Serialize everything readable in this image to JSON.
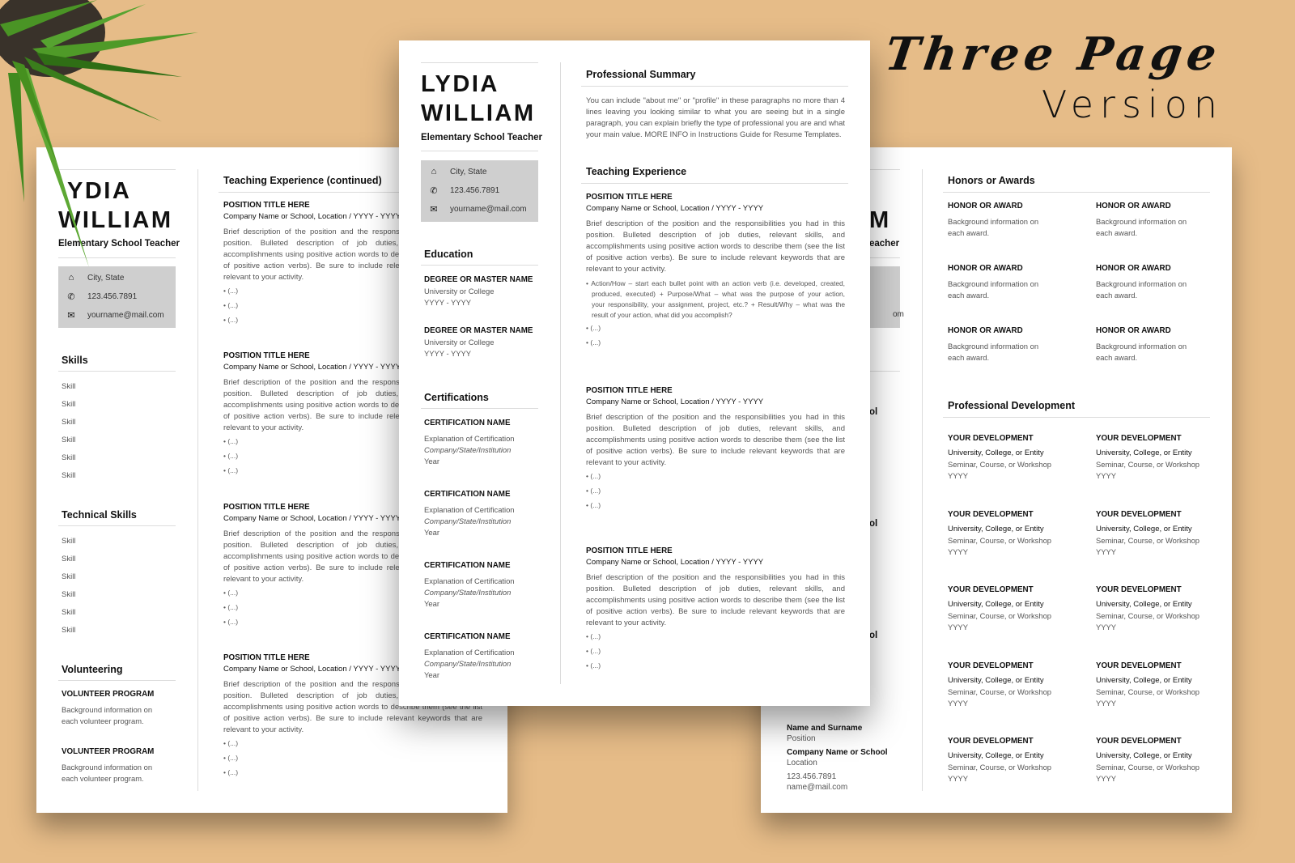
{
  "headline": {
    "line1": "Three Page",
    "line2": "Version"
  },
  "profile": {
    "first_name": "LYDIA",
    "last_name": "WILLIAM",
    "left_first_name_visible": "YDIA",
    "role": "Elementary School Teacher",
    "left_role_visible": "Elementary School Teacher",
    "right_last_name_fragment": "M",
    "right_role_fragment": "eacher",
    "right_email_fragment": "om",
    "contact": {
      "location": "City, State",
      "phone": "123.456.7891",
      "email": "yourname@mail.com"
    }
  },
  "icons": {
    "home": "home-icon",
    "phone": "phone-icon",
    "mail": "mail-icon"
  },
  "left_page": {
    "skills_title": "Skills",
    "skills": [
      "Skill",
      "Skill",
      "Skill",
      "Skill",
      "Skill",
      "Skill"
    ],
    "tech_skills_title": "Technical Skills",
    "tech_skills": [
      "Skill",
      "Skill",
      "Skill",
      "Skill",
      "Skill",
      "Skill"
    ],
    "volunteering_title": "Volunteering",
    "volunteering": [
      {
        "title": "VOLUNTEER PROGRAM",
        "l1": "Background information on",
        "l2": "each volunteer program."
      },
      {
        "title": "VOLUNTEER PROGRAM",
        "l1": "Background information on",
        "l2": "each volunteer program."
      }
    ],
    "experience_title": "Teaching Experience (continued)",
    "positions": [
      {
        "title": "POSITION TITLE HERE",
        "company": "Company Name or School, Location / YYYY - YYYY"
      },
      {
        "title": "POSITION TITLE HERE",
        "company": "Company Name or School, Location / YYYY - YYYY"
      },
      {
        "title": "POSITION TITLE HERE",
        "company": "Company Name or School, Location / YYYY - YYYY"
      },
      {
        "title": "POSITION TITLE HERE",
        "company": "Company Name or School, Location / YYYY - YYYY"
      }
    ]
  },
  "common": {
    "desc_lines": [
      "Brief description of the position and the responsibilities you had in this",
      "position. Bulleted description of job duties, relevant skills, and",
      "accomplishments using positive action words to describe them (see the list",
      "of positive action verbs). Be sure to include relevant keywords that are",
      "relevant to your activity."
    ],
    "bullet": "• (...)"
  },
  "center_page": {
    "education_title": "Education",
    "education": [
      {
        "degree": "DEGREE OR MASTER NAME",
        "school": "University or College",
        "years": "YYYY - YYYY"
      },
      {
        "degree": "DEGREE OR MASTER NAME",
        "school": "University or College",
        "years": "YYYY - YYYY"
      }
    ],
    "certifications_title": "Certifications",
    "certifications": [
      {
        "name": "CERTIFICATION NAME",
        "explanation": "Explanation of Certification",
        "issuer": "Company/State/Institution",
        "year": "Year"
      },
      {
        "name": "CERTIFICATION NAME",
        "explanation": "Explanation of Certification",
        "issuer": "Company/State/Institution",
        "year": "Year"
      },
      {
        "name": "CERTIFICATION NAME",
        "explanation": "Explanation of Certification",
        "issuer": "Company/State/Institution",
        "year": "Year"
      },
      {
        "name": "CERTIFICATION NAME",
        "explanation": "Explanation of Certification",
        "issuer": "Company/State/Institution",
        "year": "Year"
      }
    ],
    "summary_title": "Professional Summary",
    "summary_lines": [
      "You can include \"about me\" or \"profile\" in these paragraphs no more than 4",
      "lines leaving you looking similar to what you are seeing but in a single",
      "paragraph, you can explain briefly the type of professional you are and what",
      "your main value. MORE INFO in Instructions Guide for Resume Templates."
    ],
    "experience_title": "Teaching Experience",
    "positions": [
      {
        "title": "POSITION TITLE HERE",
        "company": "Company Name or School, Location / YYYY - YYYY"
      },
      {
        "title": "POSITION TITLE HERE",
        "company": "Company Name or School, Location / YYYY - YYYY"
      },
      {
        "title": "POSITION TITLE HERE",
        "company": "Company Name or School, Location / YYYY - YYYY"
      }
    ],
    "action_bullet_lines": [
      "• Action/How – start each bullet point with an action verb (i.e. developed, created,",
      "produced, executed) + Purpose/What – what was the purpose of your action,",
      "your responsibility, your assignment, project, etc.? + Result/Why – what was the",
      "result of your action, what did you accomplish?"
    ]
  },
  "right_page": {
    "honors_title": "Honors or Awards",
    "honors": [
      {
        "title": "HONOR OR AWARD",
        "l1": "Background information on",
        "l2": "each award."
      },
      {
        "title": "HONOR OR AWARD",
        "l1": "Background information on",
        "l2": "each award."
      },
      {
        "title": "HONOR OR AWARD",
        "l1": "Background information on",
        "l2": "each award."
      },
      {
        "title": "HONOR OR AWARD",
        "l1": "Background information on",
        "l2": "each award."
      },
      {
        "title": "HONOR OR AWARD",
        "l1": "Background information on",
        "l2": "each award."
      },
      {
        "title": "HONOR OR AWARD",
        "l1": "Background information on",
        "l2": "each award."
      }
    ],
    "dev_title": "Professional Development",
    "dev": [
      {
        "title": "YOUR DEVELOPMENT",
        "entity": "University, College, or Entity",
        "type": "Seminar, Course, or Workshop",
        "year": "YYYY"
      },
      {
        "title": "YOUR DEVELOPMENT",
        "entity": "University, College, or Entity",
        "type": "Seminar, Course, or Workshop",
        "year": "YYYY"
      },
      {
        "title": "YOUR DEVELOPMENT",
        "entity": "University, College, or Entity",
        "type": "Seminar, Course, or Workshop",
        "year": "YYYY"
      },
      {
        "title": "YOUR DEVELOPMENT",
        "entity": "University, College, or Entity",
        "type": "Seminar, Course, or Workshop",
        "year": "YYYY"
      },
      {
        "title": "YOUR DEVELOPMENT",
        "entity": "University, College, or Entity",
        "type": "Seminar, Course, or Workshop",
        "year": "YYYY"
      },
      {
        "title": "YOUR DEVELOPMENT",
        "entity": "University, College, or Entity",
        "type": "Seminar, Course, or Workshop",
        "year": "YYYY"
      },
      {
        "title": "YOUR DEVELOPMENT",
        "entity": "University, College, or Entity",
        "type": "Seminar, Course, or Workshop",
        "year": "YYYY"
      },
      {
        "title": "YOUR DEVELOPMENT",
        "entity": "University, College, or Entity",
        "type": "Seminar, Course, or Workshop",
        "year": "YYYY"
      },
      {
        "title": "YOUR DEVELOPMENT",
        "entity": "University, College, or Entity",
        "type": "Seminar, Course, or Workshop",
        "year": "YYYY"
      },
      {
        "title": "YOUR DEVELOPMENT",
        "entity": "University, College, or Entity",
        "type": "Seminar, Course, or Workshop",
        "year": "YYYY"
      }
    ],
    "sidebar_fragment": "ol",
    "reference": {
      "name": "Name and Surname",
      "position": "Position",
      "company": "Company Name or School",
      "location": "Location",
      "phone": "123.456.7891",
      "email": "name@mail.com"
    }
  },
  "colors": {
    "background": "#e6bc88",
    "contact_box": "#cfcfcf",
    "text": "#111111",
    "muted": "#555555"
  }
}
